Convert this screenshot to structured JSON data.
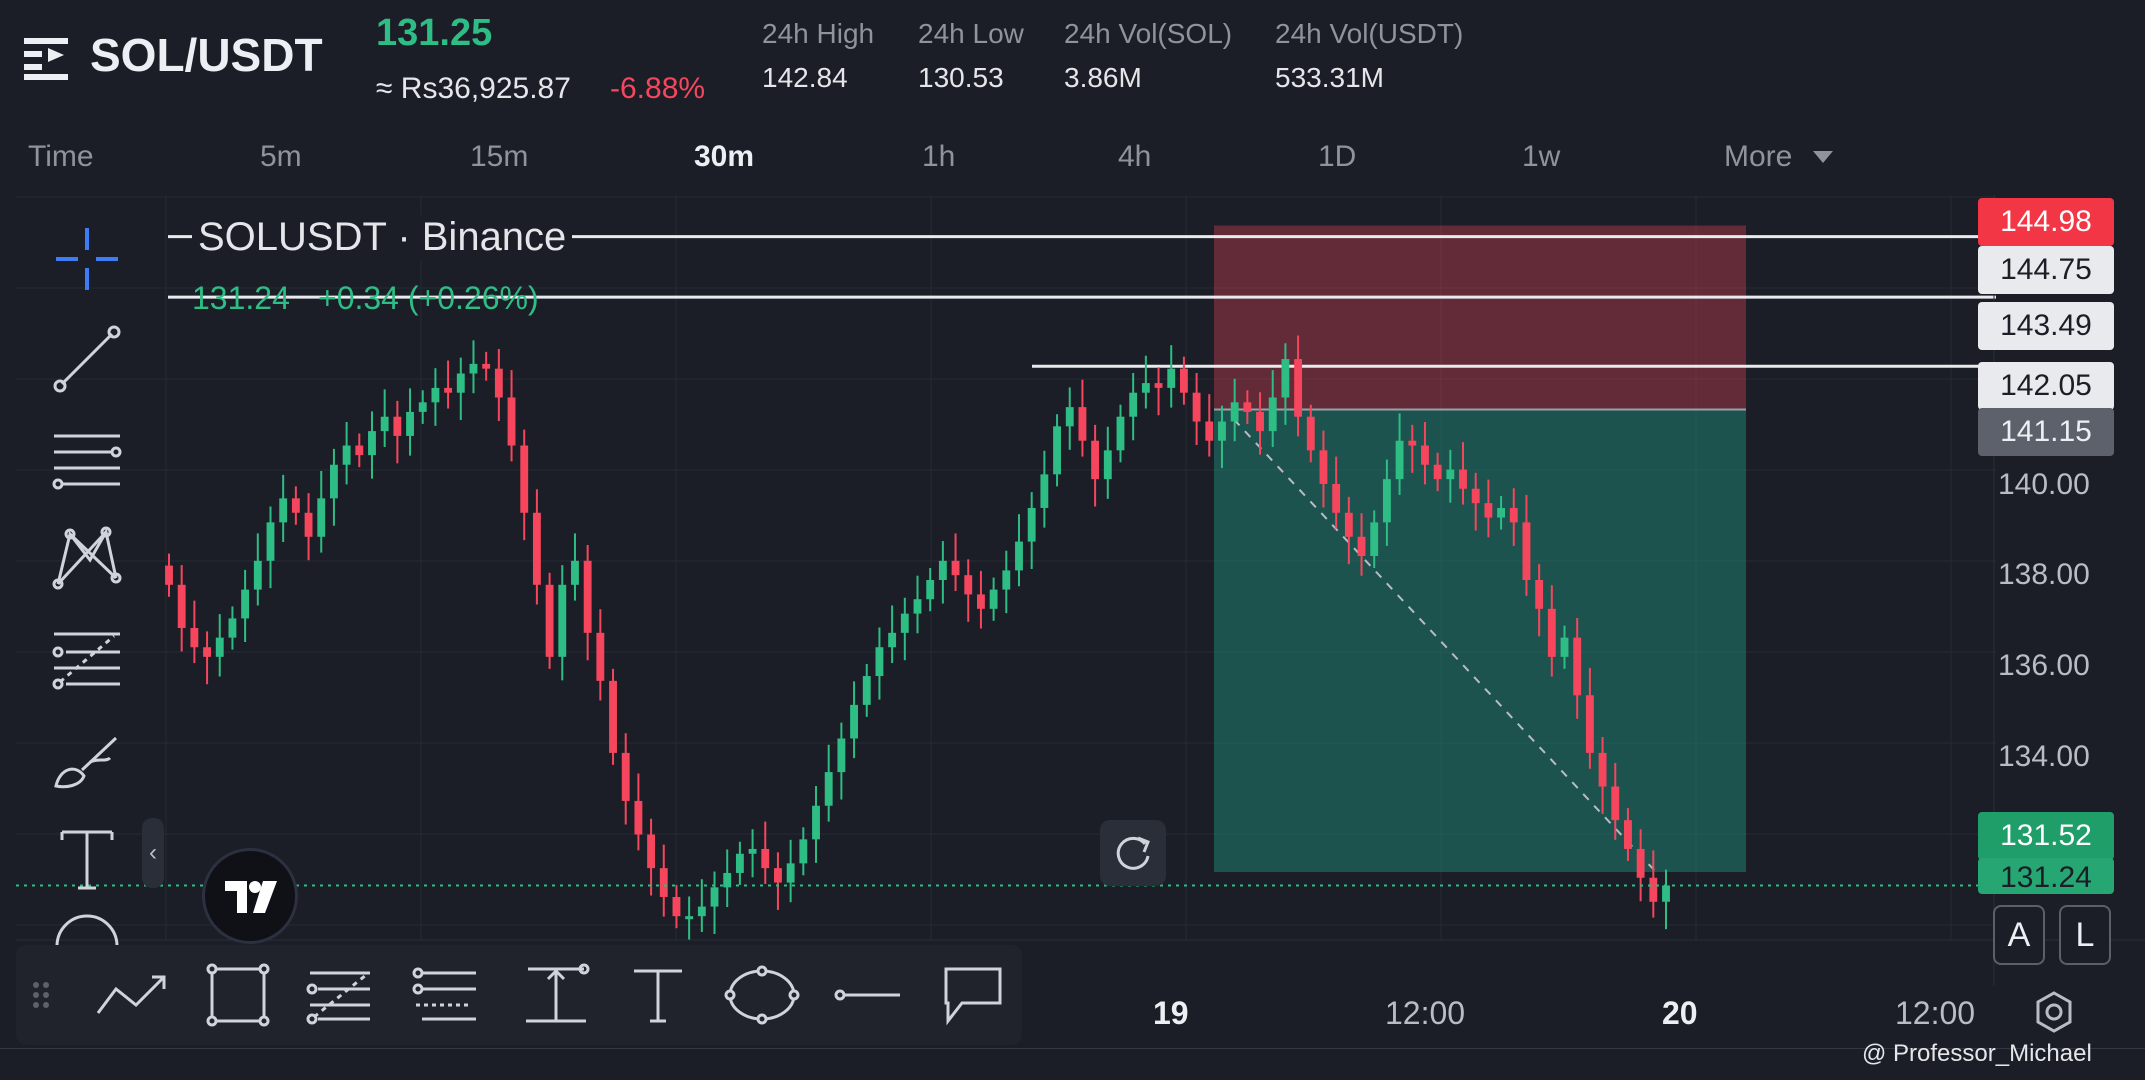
{
  "header": {
    "pair": "SOL/USDT",
    "last_price": "131.25",
    "fiat_price": "≈ Rs36,925.87",
    "change_pct": "-6.88%",
    "stats": [
      {
        "label": "24h High",
        "value": "142.84"
      },
      {
        "label": "24h Low",
        "value": "130.53"
      },
      {
        "label": "24h Vol(SOL)",
        "value": "3.86M"
      },
      {
        "label": "24h Vol(USDT)",
        "value": "533.31M"
      }
    ]
  },
  "timeframes": {
    "items": [
      "Time",
      "5m",
      "15m",
      "30m",
      "1h",
      "4h",
      "1D",
      "1w",
      "More"
    ],
    "active": "30m"
  },
  "chart": {
    "title": "SOLUSDT · Binance",
    "last_close": "131.24",
    "last_change": "+0.34 (+0.26%)",
    "price_tags": [
      {
        "label": "144.98",
        "kind": "red"
      },
      {
        "label": "144.75",
        "kind": "light"
      },
      {
        "label": "143.49",
        "kind": "light"
      },
      {
        "label": "142.05",
        "kind": "light"
      },
      {
        "label": "141.15",
        "kind": "gray"
      },
      {
        "label": "131.52",
        "kind": "green"
      },
      {
        "label": "131.24",
        "kind": "green"
      }
    ],
    "y_ticks": [
      "140.00",
      "138.00",
      "136.00",
      "134.00"
    ],
    "x_ticks": [
      "19",
      "12:00",
      "20",
      "12:00"
    ],
    "buttons": {
      "a": "A",
      "l": "L"
    },
    "watermark": "@ Professor_Michael",
    "colors": {
      "up": "#2ebd85",
      "down": "#f6465d",
      "background": "#1b1e26"
    }
  },
  "chart_data": {
    "type": "candlestick",
    "ylim": [
      130.0,
      145.2
    ],
    "close_prices": [
      137.5,
      136.6,
      136.2,
      136.0,
      136.4,
      136.8,
      137.4,
      138.0,
      138.8,
      139.3,
      139.0,
      138.5,
      139.3,
      140.0,
      140.4,
      140.2,
      140.7,
      141.0,
      140.6,
      141.1,
      141.3,
      141.6,
      141.5,
      141.9,
      142.1,
      142.0,
      141.4,
      140.4,
      139.0,
      137.5,
      136.0,
      137.5,
      138.0,
      136.5,
      135.5,
      134.0,
      133.0,
      132.3,
      131.6,
      131.0,
      130.6,
      130.6,
      130.8,
      131.2,
      131.5,
      131.9,
      132.0,
      131.6,
      131.3,
      131.7,
      132.2,
      132.9,
      133.6,
      134.3,
      135.0,
      135.6,
      136.2,
      136.5,
      136.9,
      137.2,
      137.6,
      138.0,
      137.7,
      137.3,
      137.0,
      137.4,
      137.8,
      138.4,
      139.1,
      139.8,
      140.8,
      141.2,
      140.5,
      139.7,
      140.3,
      141.0,
      141.5,
      141.7,
      141.6,
      142.0,
      141.5,
      140.9,
      140.5,
      140.9,
      141.3,
      141.1,
      140.7,
      141.4,
      142.2,
      141.0,
      140.3,
      139.6,
      139.0,
      138.5,
      138.1,
      138.8,
      139.7,
      140.5,
      140.4,
      140.0,
      139.7,
      139.9,
      139.5,
      139.2,
      138.9,
      139.1,
      138.8,
      137.6,
      137.0,
      136.0,
      136.4,
      135.2,
      134.0,
      133.3,
      132.6,
      132.0,
      131.4,
      130.9,
      131.24
    ],
    "series_colors": {
      "up": "#2ebd85",
      "down": "#f6465d"
    },
    "horizontal_levels": [
      144.75,
      143.49,
      142.05
    ],
    "position_tool": {
      "entry": 141.15,
      "stop": 144.98,
      "target": 131.52
    },
    "current_price": 131.24
  },
  "icons": {
    "left_toolbar": [
      "crosshair-icon",
      "trendline-icon",
      "parallel-channel-icon",
      "pattern-icon",
      "fib-icon",
      "brush-icon",
      "text-icon",
      "more-tools-icon"
    ],
    "bottom_toolbar": [
      "drag-handle-icon",
      "zigzag-icon",
      "rectangle-icon",
      "fib-retracement-icon",
      "fib-channel-icon",
      "price-range-icon",
      "text-tool-icon",
      "ellipse-icon",
      "horizontal-ray-icon",
      "callout-icon"
    ]
  }
}
